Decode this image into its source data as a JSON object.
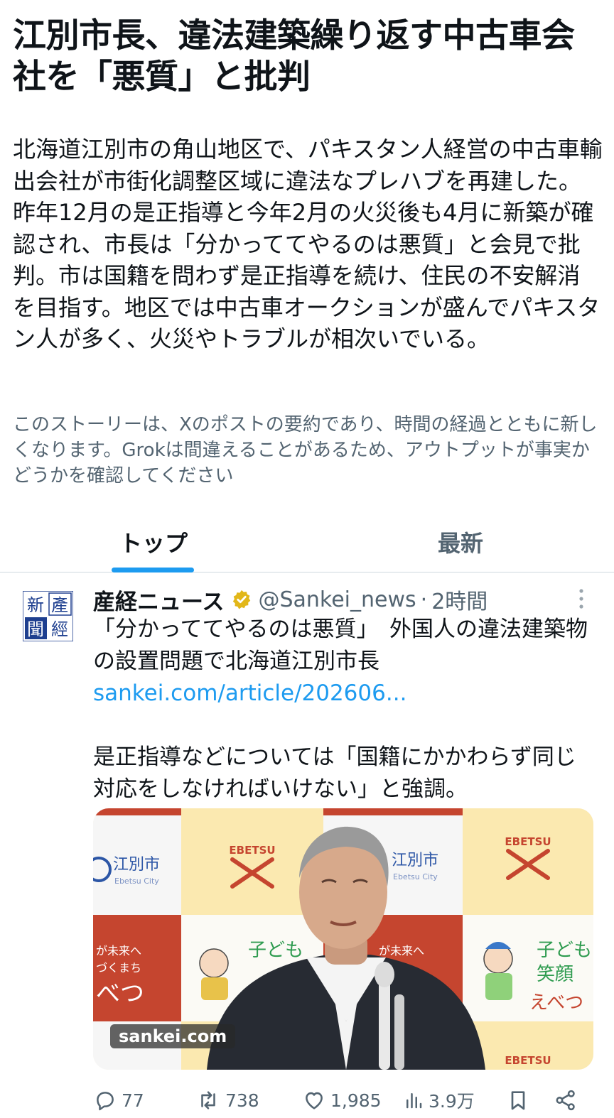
{
  "story": {
    "title": "江別市長、違法建築繰り返す中古車会社を「悪質」と批判",
    "summary": "北海道江別市の角山地区で、パキスタン人経営の中古車輸出会社が市街化調整区域に違法なプレハブを再建した。昨年12月の是正指導と今年2月の火災後も4月に新築が確認され、市長は「分かっててやるのは悪質」と会見で批判。市は国籍を問わず是正指導を続け、住民の不安解消を目指す。地区では中古車オークションが盛んでパキスタン人が多く、火災やトラブルが相次いでいる。",
    "disclaimer": "このストーリーは、Xのポストの要約であり、時間の経過とともに新しくなります。Grokは間違えることがあるため、アウトプットが事実かどうかを確認してください"
  },
  "tabs": {
    "top": "トップ",
    "latest": "最新"
  },
  "post": {
    "author_name": "産経ニュース",
    "handle": "@Sankei_news",
    "dot": "·",
    "time": "2時間",
    "avatar_text": "產經新聞",
    "text_line1": "「分かっててやるのは悪質」　外国人の違法建築物の設置問題で北海道江別市長",
    "link": "sankei.com/article/202606...",
    "text_line2": "是正指導などについては「国籍にかかわらず同じ対応をしなければいけない」と強調。",
    "media": {
      "source_label": "sankei.com",
      "backdrop_text": {
        "city_jp": "江別市",
        "city_en": "Ebetsu City",
        "ebetsu": "EBETSU",
        "slogan1": "が未来へ",
        "slogan2": "づくまち",
        "slogan3": "べつ",
        "kodomo": "子ども",
        "egao": "笑顔",
        "ebetsu_kana": "えべつ"
      }
    },
    "stats": {
      "replies": "77",
      "reposts": "738",
      "likes": "1,985",
      "views": "3.9万"
    }
  },
  "colors": {
    "accent": "#1d9bf0",
    "secondary_text": "#536471",
    "verified_gold": "#e2b719",
    "avatar_blue": "#1e3f8f"
  }
}
